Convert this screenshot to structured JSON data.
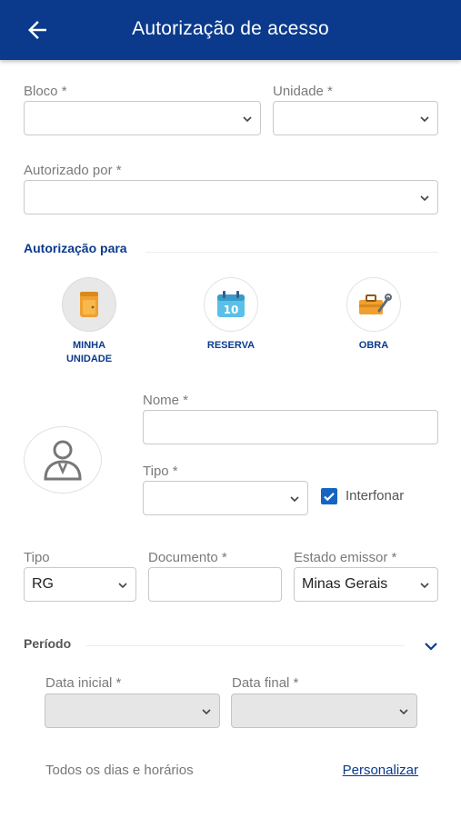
{
  "header": {
    "title": "Autorização de acesso",
    "back_icon": "arrow-left-icon"
  },
  "form": {
    "bloco": {
      "label": "Bloco *",
      "value": ""
    },
    "unidade": {
      "label": "Unidade *",
      "value": ""
    },
    "autorizado_por": {
      "label": "Autorizado por *",
      "value": ""
    }
  },
  "autorizacao": {
    "title": "Autorização para",
    "options": [
      {
        "label": "MINHA UNIDADE",
        "icon": "door-icon",
        "selected": true
      },
      {
        "label": "RESERVA",
        "icon": "calendar-icon",
        "selected": false
      },
      {
        "label": "OBRA",
        "icon": "toolbox-icon",
        "selected": false
      }
    ],
    "calendar_day": "10"
  },
  "pessoa": {
    "avatar_icon": "person-icon",
    "nome": {
      "label": "Nome *",
      "value": ""
    },
    "tipo": {
      "label": "Tipo *",
      "value": ""
    },
    "interfonar": {
      "label": "Interfonar",
      "checked": true
    }
  },
  "documento": {
    "tipo": {
      "label": "Tipo",
      "value": "RG"
    },
    "numero": {
      "label": "Documento *",
      "value": ""
    },
    "estado": {
      "label": "Estado emissor *",
      "value": "Minas Gerais"
    }
  },
  "periodo": {
    "title": "Período",
    "data_inicial": {
      "label": "Data inicial *",
      "value": ""
    },
    "data_final": {
      "label": "Data final *",
      "value": ""
    },
    "todos_label": "Todos os dias e horários",
    "personalizar_label": "Personalizar"
  },
  "colors": {
    "primary": "#0b3a8c",
    "accent": "#f0a030",
    "checkbox": "#1565c0"
  }
}
